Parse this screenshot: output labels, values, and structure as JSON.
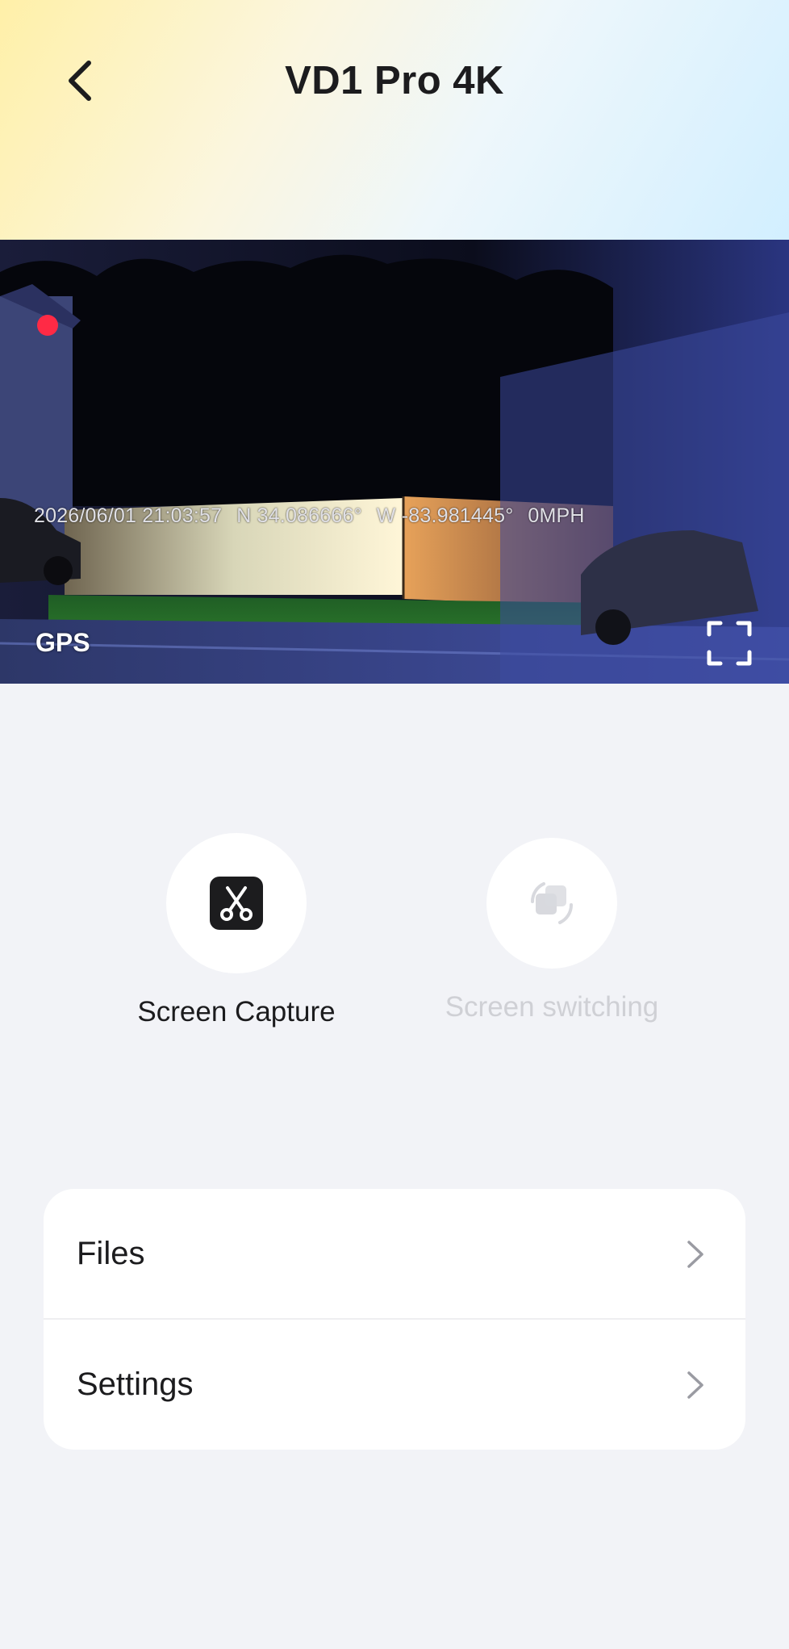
{
  "header": {
    "title": "VD1 Pro 4K",
    "back_icon": "chevron-left-icon"
  },
  "video": {
    "timestamp": "2026/06/01 21:03:57",
    "latitude": "N 34.086666°",
    "longitude": "W -83.981445°",
    "speed": "0MPH",
    "recording_indicator_color": "#ff2a45",
    "gps_label": "GPS",
    "fullscreen_icon": "fullscreen-icon"
  },
  "actions": {
    "capture": {
      "label": "Screen Capture",
      "icon": "scissors-icon",
      "enabled": true
    },
    "switching": {
      "label": "Screen switching",
      "icon": "camera-switch-icon",
      "enabled": false
    }
  },
  "menu": {
    "items": [
      {
        "label": "Files",
        "icon": "chevron-right-icon"
      },
      {
        "label": "Settings",
        "icon": "chevron-right-icon"
      }
    ]
  }
}
